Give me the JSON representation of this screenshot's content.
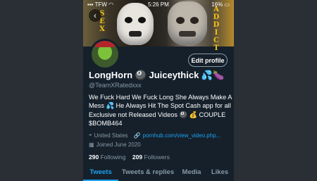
{
  "status_bar": {
    "carrier": "TFW",
    "time": "5:26 PM",
    "battery": "16%"
  },
  "banner": {
    "left_side_letters": "S E X",
    "right_side_letters": "A D D I C T"
  },
  "profile": {
    "edit_label": "Edit profile",
    "display_name": "LongHorn 🎱 Juiceythick 💦🍆",
    "handle": "@TeamXRatedxxx",
    "bio": "We Fuck Hard We Fuck Long She Always Make A Mess 💦 He Always Hit The Spot Cash app for all Exclusive not Released Videos 🎱 💰 COUPLE $BOMB464",
    "location": "United States",
    "website": "pornhub.com/view_video.php...",
    "joined": "Joined June 2020",
    "following_count": "290",
    "following_label": "Following",
    "followers_count": "209",
    "followers_label": "Followers"
  },
  "tabs": [
    {
      "label": "Tweets",
      "active": true
    },
    {
      "label": "Tweets & replies",
      "active": false
    },
    {
      "label": "Media",
      "active": false
    },
    {
      "label": "Likes",
      "active": false
    }
  ],
  "colors": {
    "background": "#15202b",
    "accent": "#1da1f2",
    "muted": "#8899a6"
  }
}
